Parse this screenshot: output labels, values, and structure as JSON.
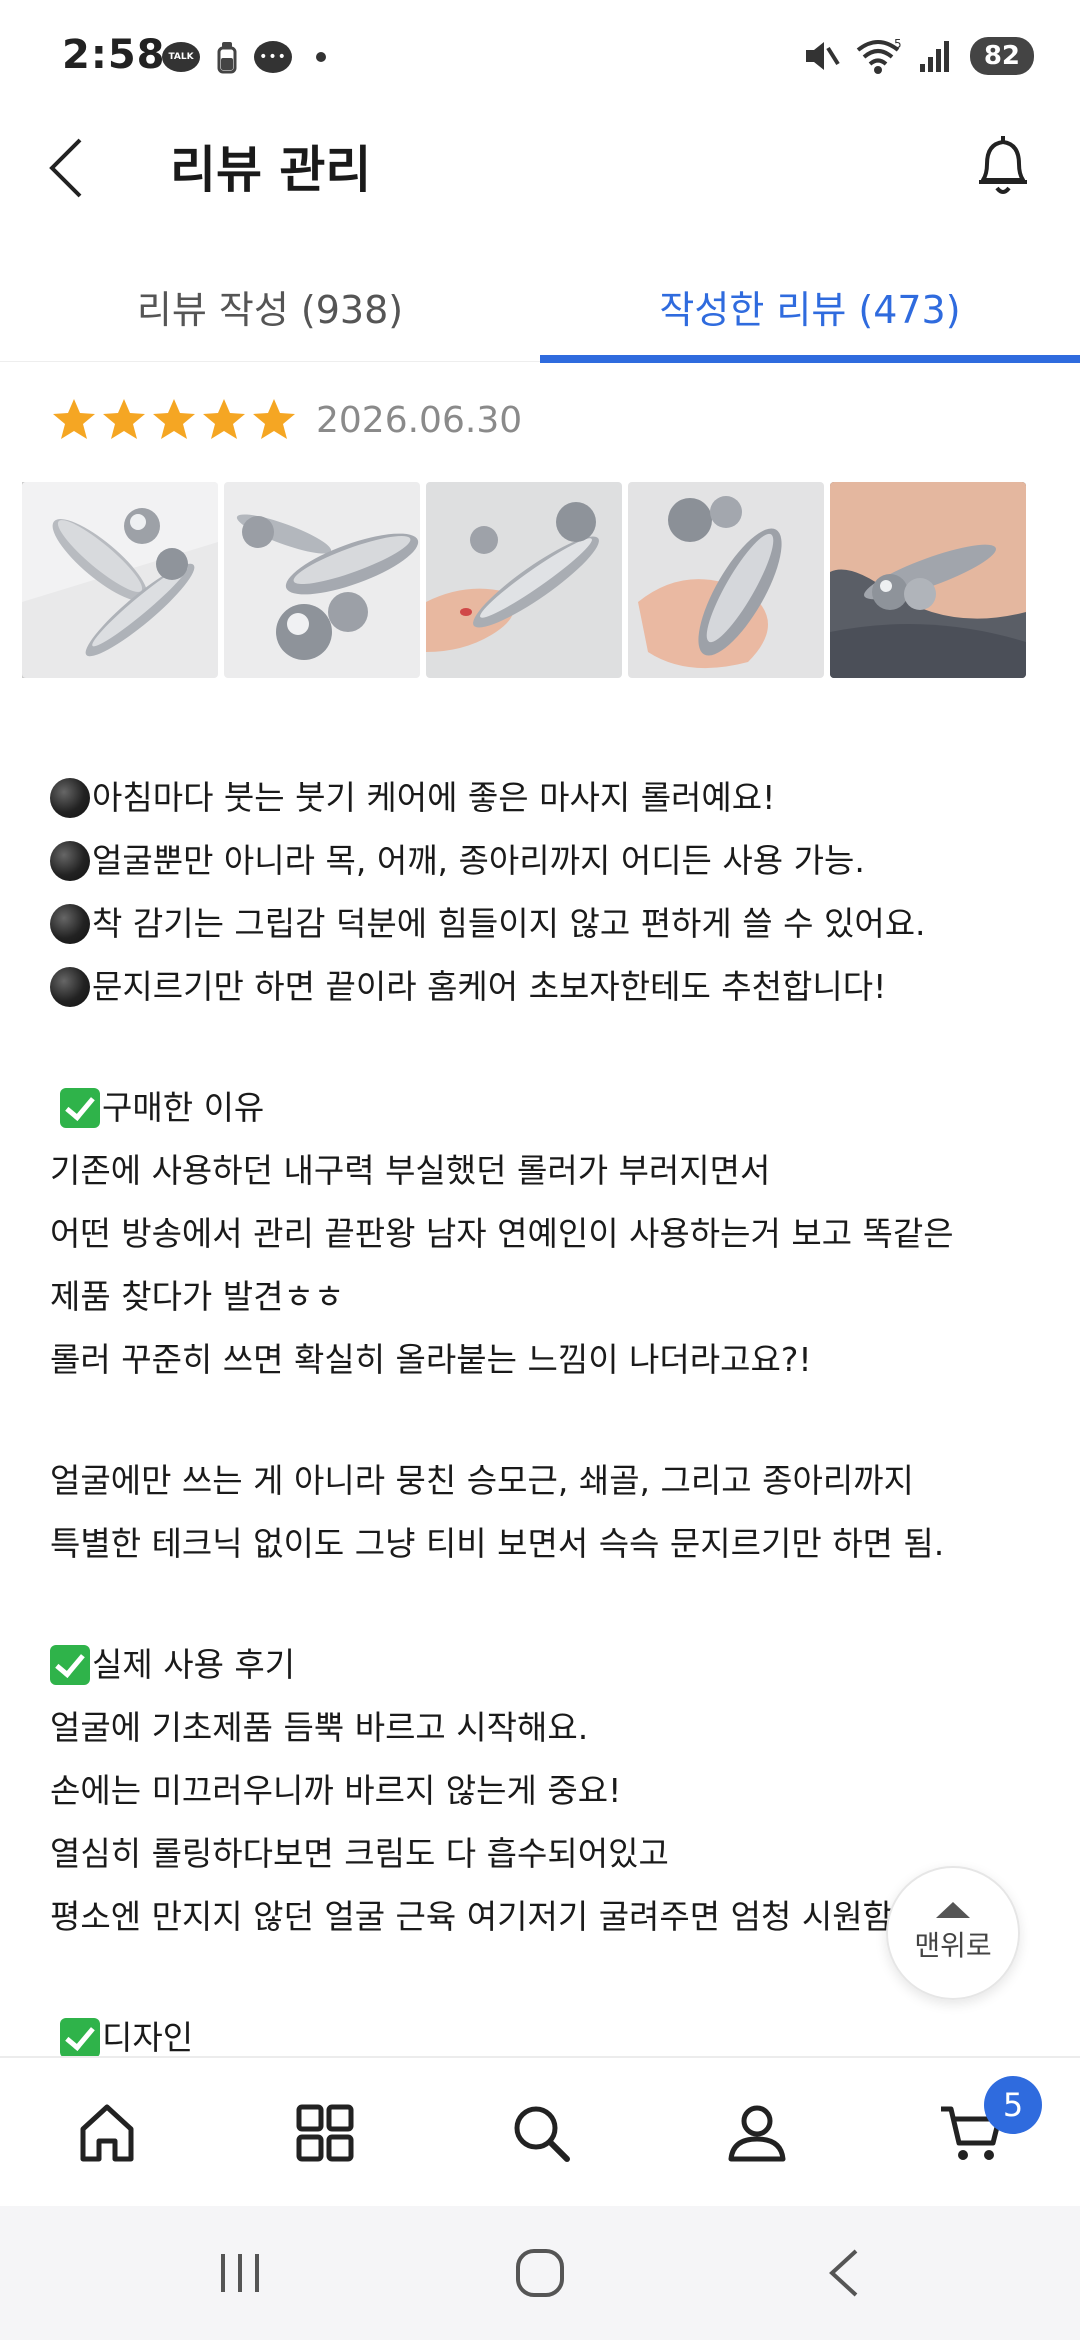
{
  "status_bar": {
    "time": "2:58",
    "talk_label": "TALK",
    "battery": "82",
    "wifi_tag": "5"
  },
  "header": {
    "title": "리뷰 관리"
  },
  "tabs": [
    {
      "label": "리뷰 작성 (938)",
      "active": false
    },
    {
      "label": "작성한 리뷰 (473)",
      "active": true
    }
  ],
  "review": {
    "rating": 5,
    "date": "2026.06.30",
    "image_count": 5,
    "lines": [
      {
        "type": "bullet",
        "text": "아침마다 붓는 붓기 케어에 좋은 마사지 롤러예요!"
      },
      {
        "type": "bullet",
        "text": "얼굴뿐만 아니라 목, 어깨, 종아리까지 어디든 사용 가능."
      },
      {
        "type": "bullet",
        "text": "착 감기는 그립감 덕분에 힘들이지 않고 편하게 쓸 수 있어요."
      },
      {
        "type": "bullet",
        "text": "문지르기만 하면 끝이라 홈케어 초보자한테도 추천합니다!"
      },
      {
        "type": "blank",
        "text": ""
      },
      {
        "type": "check-indent",
        "text": "구매한 이유"
      },
      {
        "type": "text",
        "text": "기존에 사용하던 내구력 부실했던 롤러가 부러지면서"
      },
      {
        "type": "text",
        "text": "어떤 방송에서 관리 끝판왕 남자 연예인이 사용하는거 보고 똑같은"
      },
      {
        "type": "text",
        "text": "제품 찾다가 발견ㅎㅎ"
      },
      {
        "type": "text",
        "text": "롤러 꾸준히 쓰면 확실히 올라붙는 느낌이 나더라고요?!"
      },
      {
        "type": "blank",
        "text": ""
      },
      {
        "type": "text",
        "text": "얼굴에만 쓰는 게 아니라 뭉친 승모근, 쇄골, 그리고 종아리까지"
      },
      {
        "type": "text",
        "text": "특별한 테크닉 없이도 그냥 티비 보면서 슥슥 문지르기만 하면 됨."
      },
      {
        "type": "blank",
        "text": ""
      },
      {
        "type": "check",
        "text": "실제 사용 후기"
      },
      {
        "type": "text",
        "text": "얼굴에 기초제품 듬뿍 바르고 시작해요."
      },
      {
        "type": "text",
        "text": "손에는 미끄러우니까 바르지 않는게 중요!"
      },
      {
        "type": "text",
        "text": "열심히 롤링하다보면 크림도 다 흡수되어있고"
      },
      {
        "type": "text",
        "text": "평소엔 만지지 않던 얼굴 근육 여기저기 굴려주면 엄청 시원함"
      },
      {
        "type": "blank",
        "text": ""
      },
      {
        "type": "check-indent",
        "text": "디자인"
      }
    ]
  },
  "scroll_top": {
    "label": "맨위로"
  },
  "bottom_nav": {
    "items": [
      {
        "icon": "home-icon"
      },
      {
        "icon": "grid-icon"
      },
      {
        "icon": "search-icon"
      },
      {
        "icon": "user-icon"
      },
      {
        "icon": "cart-icon"
      }
    ],
    "cart_count": "5"
  },
  "colors": {
    "accent": "#2f6bde",
    "star": "#f5a623",
    "check": "#2fb34a"
  }
}
